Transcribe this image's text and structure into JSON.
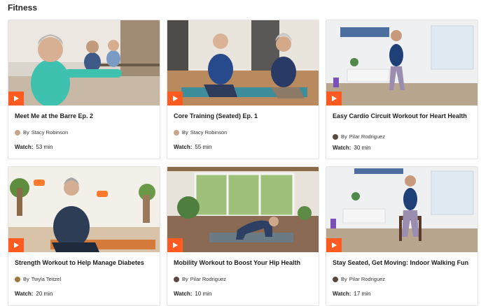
{
  "section": {
    "title": "Fitness"
  },
  "common": {
    "by_prefix": "By",
    "watch_label": "Watch:"
  },
  "cards": [
    {
      "title": "Meet Me at the Barre Ep. 2",
      "author": "Stacy Robinson",
      "duration": "53 min",
      "avatar_color": "#c9a58a"
    },
    {
      "title": "Core Training (Seated) Ep. 1",
      "author": "Stacy Robinson",
      "duration": "55 min",
      "avatar_color": "#c9a58a"
    },
    {
      "title": "Easy Cardio Circuit Workout for Heart Health",
      "author": "Pilar Rodriguez",
      "duration": "30 min",
      "avatar_color": "#5a4a3e"
    },
    {
      "title": "Strength Workout to Help Manage Diabetes",
      "author": "Twyla Teitzel",
      "duration": "20 min",
      "avatar_color": "#a07a3a"
    },
    {
      "title": "Mobility Workout to Boost Your Hip Health",
      "author": "Pilar Rodriguez",
      "duration": "10 min",
      "avatar_color": "#5a4a3e"
    },
    {
      "title": "Stay Seated, Get Moving: Indoor Walking Fun",
      "author": "Pilar Rodriguez",
      "duration": "17 min",
      "avatar_color": "#5a4a3e"
    }
  ],
  "colors": {
    "play_button": "#ff5a1f",
    "accent": "#ff5a1f"
  },
  "icons": {
    "play": "play-icon"
  }
}
